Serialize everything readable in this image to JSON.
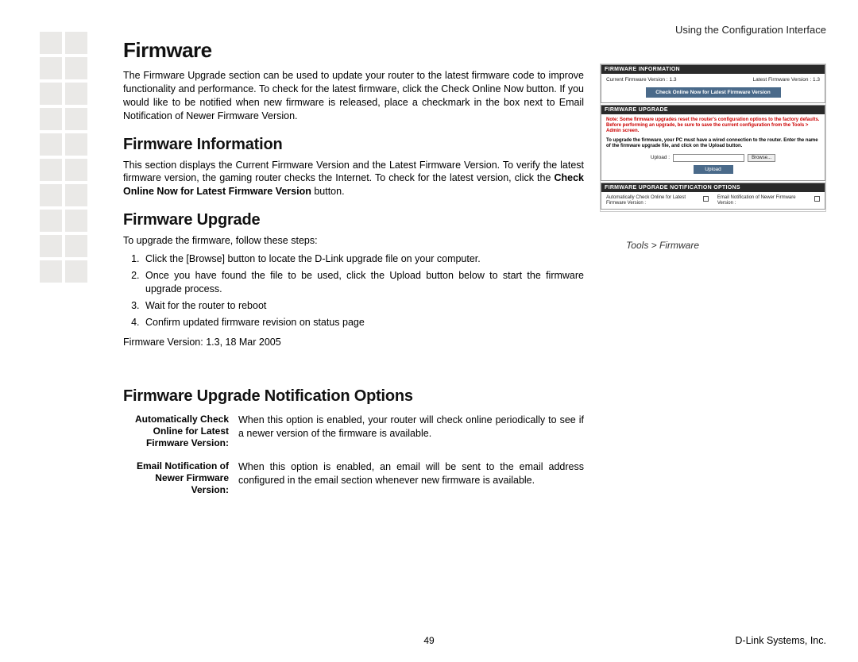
{
  "header": {
    "right": "Using the Configuration Interface"
  },
  "title": "Firmware",
  "intro": "The Firmware Upgrade section can be used to update your router to the latest firmware code to improve functionality and performance. To check for the latest firmware, click the Check Online Now button. If you would like to be notified when new firmware is released, place a checkmark in the box next to Email Notification of Newer Firmware Version.",
  "sec_info": {
    "heading": "Firmware Information",
    "body_pre": "This section displays the Current Firmware Version and the Latest Firmware Version. To verify the latest firmware version, the gaming router checks the Internet. To check for the latest version, click the ",
    "body_bold": "Check Online Now for Latest Firmware Version",
    "body_post": " button."
  },
  "sec_upgrade": {
    "heading": "Firmware Upgrade",
    "lead": "To upgrade the firmware, follow these steps:",
    "steps": [
      "Click the [Browse] button to locate the D-Link upgrade file on your computer.",
      "Once you have found the file to be used, click the Upload button below to start the firmware upgrade process.",
      "Wait for the router to reboot",
      "Confirm updated firmware revision on status page"
    ],
    "fwver": "Firmware Version: 1.3, 18 Mar 2005"
  },
  "sec_notif": {
    "heading": "Firmware Upgrade Notification Options",
    "rows": [
      {
        "label": "Automatically Check Online for Latest Firmware Version:",
        "desc": "When this option is enabled, your router will check online periodically to see if a newer version of the firmware is available."
      },
      {
        "label": "Email Notification of Newer Firmware Version:",
        "desc": "When this option is enabled, an email will be sent to the email address configured in the email section whenever new firmware is available."
      }
    ]
  },
  "shot": {
    "p1_hdr": "FIRMWARE INFORMATION",
    "p1_cur": "Current Firmware Version :  1.3",
    "p1_lat": "Latest Firmware Version :  1.3",
    "p1_btn": "Check Online Now for Latest Firmware Version",
    "p2_hdr": "FIRMWARE UPGRADE",
    "p2_note1": "Note: Some firmware upgrades reset the router's configuration options to the factory defaults. Before performing an upgrade, be sure to save the current configuration from the Tools > Admin screen.",
    "p2_note2": "To upgrade the firmware, your PC must have a wired connection to the router. Enter the name of the firmware upgrade file, and click on the Upload button.",
    "p2_upload_lbl": "Upload :",
    "p2_browse": "Browse...",
    "p2_upload_btn": "Upload",
    "p3_hdr": "FIRMWARE UPGRADE NOTIFICATION OPTIONS",
    "p3_opt1": "Automatically Check Online for Latest Firmware Version :",
    "p3_opt2": "Email Notification of Newer Firmware Version :"
  },
  "caption": "Tools > Firmware",
  "pagenum": "49",
  "footer_right": "D-Link Systems, Inc."
}
